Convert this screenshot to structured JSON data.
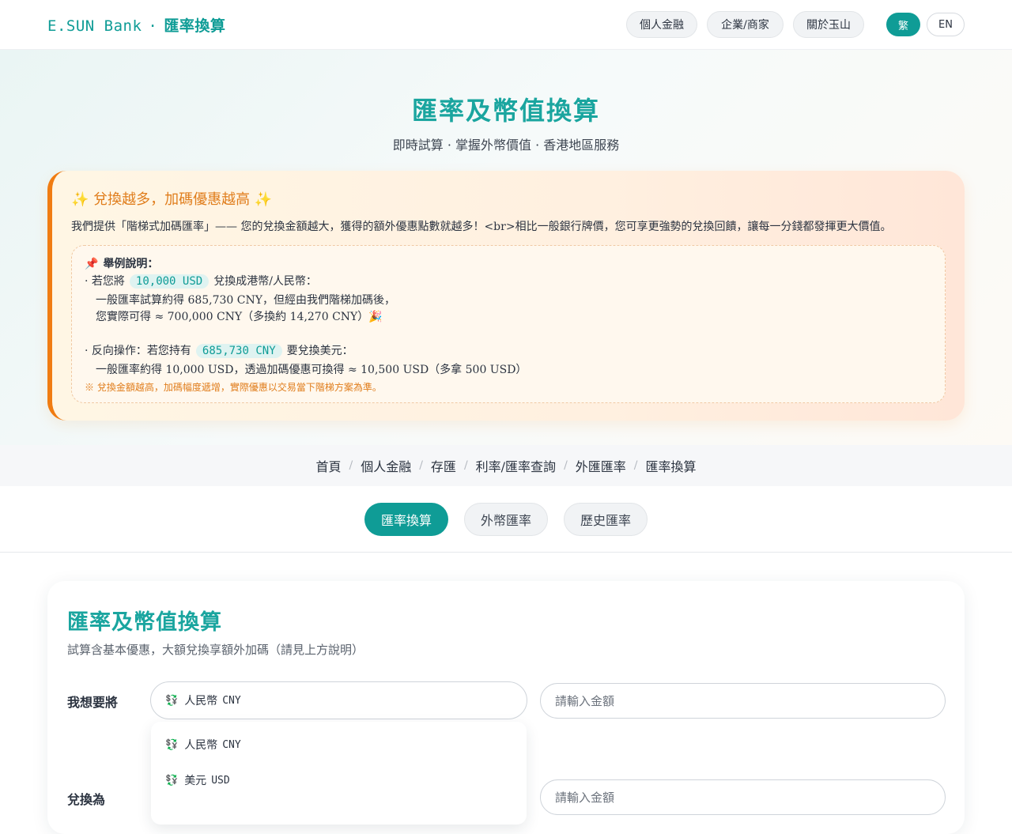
{
  "header": {
    "brand": "E.SUN Bank",
    "brand_sep": "·",
    "brand_zh": "匯率換算",
    "nav": [
      "個人金融",
      "企業/商家",
      "關於玉山"
    ],
    "lang_active": "繁",
    "lang_other": "EN"
  },
  "hero": {
    "title": "匯率及幣值換算",
    "subtitle": "即時試算 · 掌握外幣價值 · 香港地區服務"
  },
  "promo": {
    "spark": "✨",
    "title": "兌換越多，加碼優惠越高",
    "description": "我們提供「階梯式加碼匯率」—— 您的兌換金額越大，獲得的額外優惠點數就越多！<br>相比一般銀行牌價，您可享更強勢的兌換回饋，讓每一分錢都發揮更大價值。",
    "example_pin": "📌",
    "example_heading": "舉例說明：",
    "ex1_prefix": "· 若您將",
    "ex1_chip": "10,000 USD",
    "ex1_suffix": "兌換成港幣/人民幣：",
    "ex1_line2": "一般匯率試算約得 685,730 CNY，但經由我們階梯加碼後，",
    "ex1_line3": "您實際可得 ≈ 700,000 CNY（多換約 14,270 CNY）🎉",
    "ex2_prefix": "· 反向操作：若您持有",
    "ex2_chip": "685,730 CNY",
    "ex2_suffix": "要兌換美元：",
    "ex2_line2": "一般匯率約得 10,000 USD，透過加碼優惠可換得 ≈ 10,500 USD（多拿 500 USD）",
    "note": "※ 兌換金額越高，加碼幅度遞增，實際優惠以交易當下階梯方案為準。"
  },
  "breadcrumb": [
    "首頁",
    "個人金融",
    "存匯",
    "利率/匯率查詢",
    "外匯匯率",
    "匯率換算"
  ],
  "breadcrumb_sep": "/",
  "tabs": [
    "匯率換算",
    "外幣匯率",
    "歷史匯率"
  ],
  "calculator": {
    "title": "匯率及幣值換算",
    "subtitle": "試算含基本優惠，大額兌換享額外加碼（請見上方說明）",
    "from_label": "我想要將",
    "to_label": "兌換為",
    "currency_icon": "💱",
    "selected_currency_name": "人民幣",
    "selected_currency_code": "CNY",
    "amount_placeholder": "請輸入金額",
    "options": [
      {
        "name": "人民幣",
        "code": "CNY"
      },
      {
        "name": "美元",
        "code": "USD"
      }
    ]
  }
}
